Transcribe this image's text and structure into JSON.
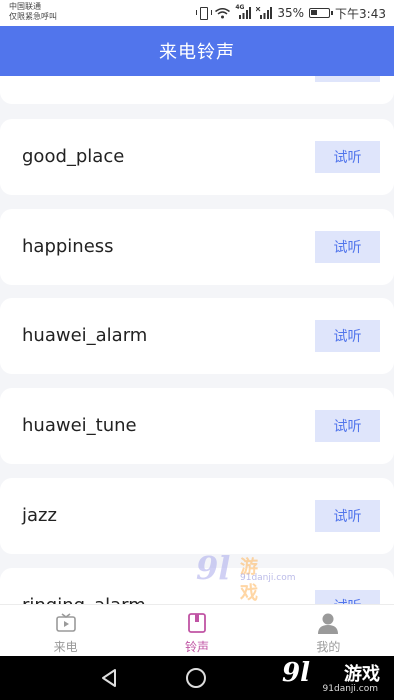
{
  "status_bar": {
    "carrier_line1": "中国联通",
    "carrier_line2": "仅限紧急呼叫",
    "signal_tag_4g": "4G",
    "battery": "35%",
    "time": "下午3:43"
  },
  "header": {
    "title": "来电铃声"
  },
  "ringtones": [
    {
      "name": "",
      "try_label": ""
    },
    {
      "name": "good_place",
      "try_label": "试听"
    },
    {
      "name": "happiness",
      "try_label": "试听"
    },
    {
      "name": "huawei_alarm",
      "try_label": "试听"
    },
    {
      "name": "huawei_tune",
      "try_label": "试听"
    },
    {
      "name": "jazz",
      "try_label": "试听"
    },
    {
      "name": "ringing_alarm",
      "try_label": "试听"
    }
  ],
  "tabs": [
    {
      "label": "来电",
      "icon": "play-video-icon",
      "active": false
    },
    {
      "label": "铃声",
      "icon": "bookmark-icon",
      "active": true
    },
    {
      "label": "我的",
      "icon": "user-icon",
      "active": false
    }
  ],
  "watermark": {
    "brand": "9l",
    "text": "游戏",
    "url": "91danji.com"
  },
  "colors": {
    "accent": "#5175ec",
    "active_tab": "#c054a4",
    "button_bg": "#dfe5fb"
  }
}
